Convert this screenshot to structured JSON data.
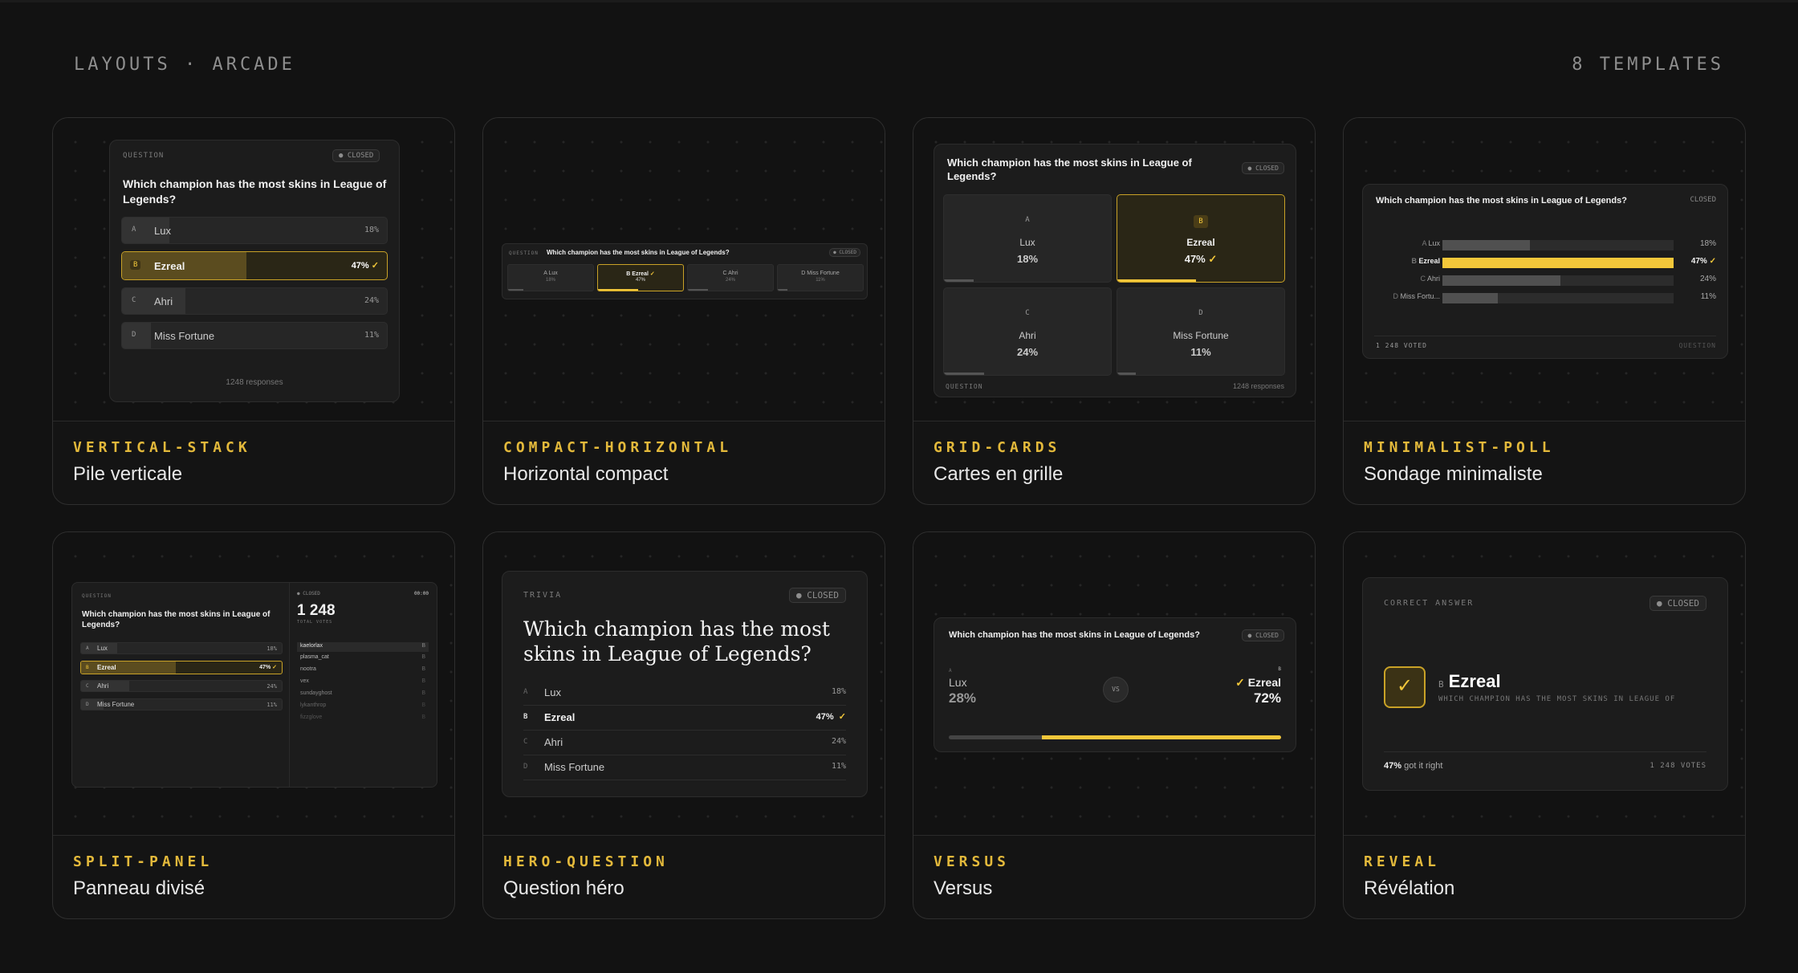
{
  "header": {
    "left": "LAYOUTS · ARCADE",
    "right": "8 TEMPLATES"
  },
  "poll": {
    "question": "Which champion has the most skins in League of Legends?",
    "status": "CLOSED",
    "responses": "1248 responses",
    "voted": "1 248 VOTED",
    "total": "1 248",
    "total_label": "TOTAL VOTES",
    "votes": "1 248 VOTES",
    "timer": "00:00",
    "options": [
      {
        "key": "A",
        "name": "Lux",
        "pct": "18%",
        "value": 18
      },
      {
        "key": "B",
        "name": "Ezreal",
        "pct": "47%",
        "value": 47
      },
      {
        "key": "C",
        "name": "Ahri",
        "pct": "24%",
        "value": 24
      },
      {
        "key": "D",
        "name": "Miss Fortune",
        "pct": "11%",
        "value": 11
      }
    ],
    "mini_d_name": "Miss Fortu...",
    "check": "✓"
  },
  "labels": {
    "question": "QUESTION",
    "trivia": "TRIVIA",
    "correct_answer": "CORRECT ANSWER",
    "vs": "VS"
  },
  "split": {
    "voters": [
      "kaelorlax",
      "plasma_cat",
      "nootra",
      "vex",
      "sundayghost",
      "lykanthrop",
      "fizzglove"
    ]
  },
  "versus": {
    "left_name": "Lux",
    "left_pct": "28%",
    "right_name": "Ezreal",
    "right_pct": "72%",
    "right_value": 72
  },
  "reveal": {
    "name": "Ezreal",
    "sub": "WHICH CHAMPION HAS THE MOST SKINS IN LEAGUE OF",
    "got_pct": "47%",
    "got_text": "got it right"
  },
  "cards": [
    {
      "slug": "VERTICAL-STACK",
      "name": "Pile verticale"
    },
    {
      "slug": "COMPACT-HORIZONTAL",
      "name": "Horizontal compact"
    },
    {
      "slug": "GRID-CARDS",
      "name": "Cartes en grille"
    },
    {
      "slug": "MINIMALIST-POLL",
      "name": "Sondage minimaliste"
    },
    {
      "slug": "SPLIT-PANEL",
      "name": "Panneau divisé"
    },
    {
      "slug": "HERO-QUESTION",
      "name": "Question héro"
    },
    {
      "slug": "VERSUS",
      "name": "Versus"
    },
    {
      "slug": "REVEAL",
      "name": "Révélation"
    }
  ],
  "colors": {
    "accent": "#f3c73a",
    "background": "#121212"
  }
}
